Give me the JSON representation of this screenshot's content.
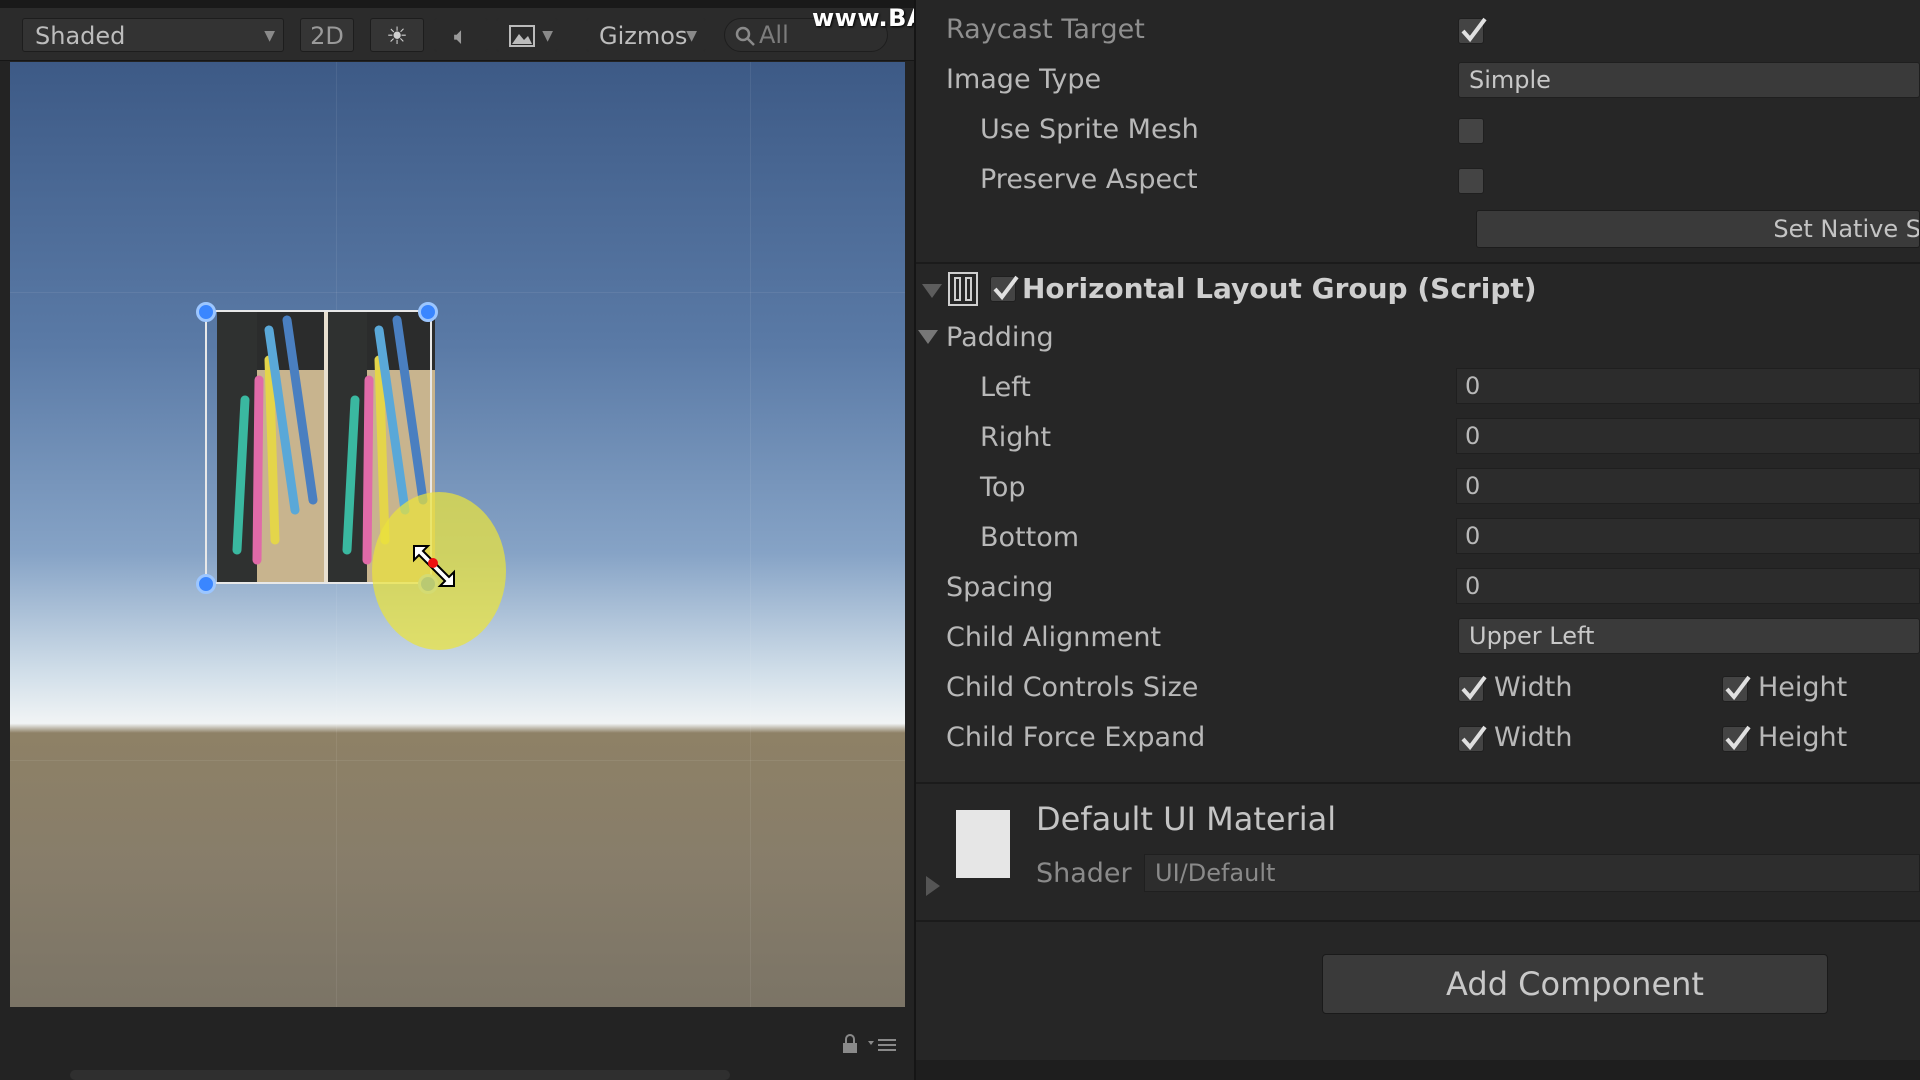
{
  "watermark": "www.BANDICAM.com",
  "scene": {
    "toolbar": {
      "draw_mode": "Shaded",
      "mode_2d": "2D",
      "gizmos": "Gizmos",
      "search_placeholder": "All"
    }
  },
  "inspector": {
    "raycast_target": {
      "label": "Raycast Target",
      "checked": true
    },
    "image_type": {
      "label": "Image Type",
      "value": "Simple"
    },
    "use_sprite_mesh": {
      "label": "Use Sprite Mesh",
      "checked": false
    },
    "preserve_aspect": {
      "label": "Preserve Aspect",
      "checked": false
    },
    "set_native_size": "Set Native Size",
    "hlg": {
      "title": "Horizontal Layout Group (Script)",
      "enabled": true,
      "padding": {
        "label": "Padding",
        "left_label": "Left",
        "left": "0",
        "right_label": "Right",
        "right": "0",
        "top_label": "Top",
        "top": "0",
        "bottom_label": "Bottom",
        "bottom": "0"
      },
      "spacing_label": "Spacing",
      "spacing": "0",
      "child_alignment_label": "Child Alignment",
      "child_alignment": "Upper Left",
      "child_controls_size": {
        "label": "Child Controls Size",
        "width_label": "Width",
        "height_label": "Height",
        "width": true,
        "height": true
      },
      "child_force_expand": {
        "label": "Child Force Expand",
        "width_label": "Width",
        "height_label": "Height",
        "width": true,
        "height": true
      }
    },
    "material": {
      "name": "Default UI Material",
      "shader_label": "Shader",
      "shader": "UI/Default"
    },
    "add_component": "Add Component"
  },
  "colors": {
    "accent_handle": "#3a86ff",
    "cursor_highlight": "#eae33c",
    "inspector_bg": "#262626"
  },
  "icons": [
    "search-icon",
    "sun-icon",
    "audio-icon",
    "image-effects-icon",
    "lock-icon",
    "menu-icon",
    "checkmark-icon",
    "layout-group-icon",
    "resize-cursor-icon"
  ]
}
